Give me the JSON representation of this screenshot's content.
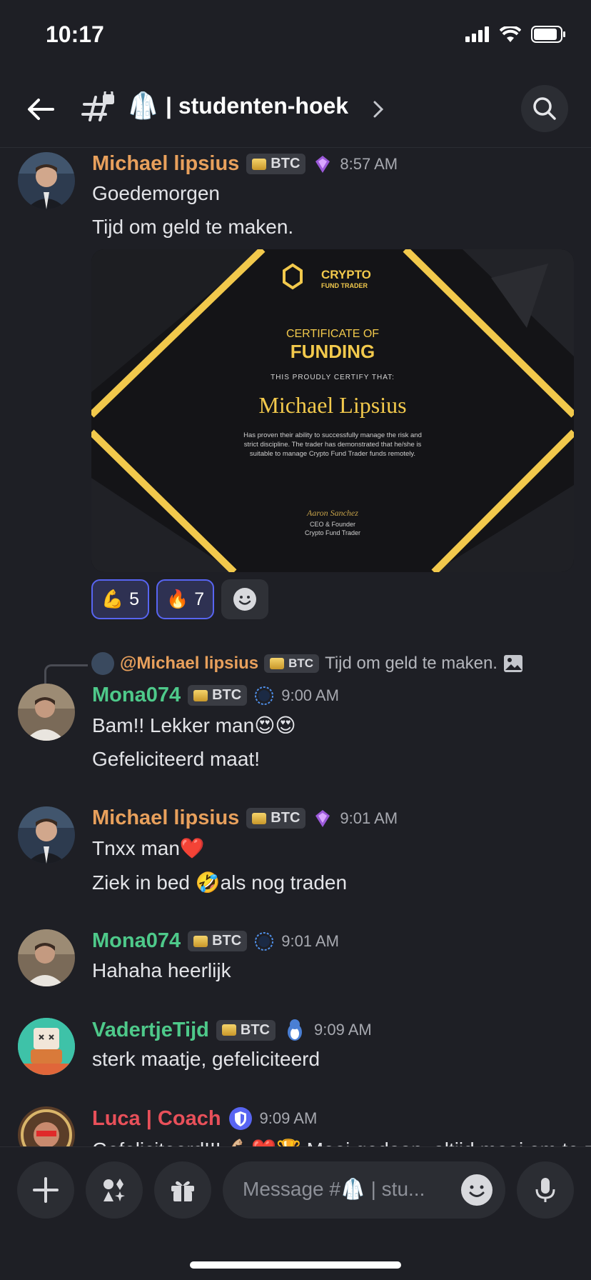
{
  "status": {
    "time": "10:17"
  },
  "header": {
    "channel_emoji": "🥼",
    "title": "| studenten-hoek"
  },
  "messages": [
    {
      "author": "Michael lipsius",
      "badge": "BTC",
      "time": "8:57 AM",
      "lines": [
        "Goedemorgen",
        "Tijd om geld te maken."
      ]
    },
    {
      "author": "Mona074",
      "badge": "BTC",
      "time": "9:00 AM",
      "lines": [
        "Bam!! Lekker man😍😍",
        "Gefeliciteerd maat!"
      ]
    },
    {
      "author": "Michael lipsius",
      "badge": "BTC",
      "time": "9:01 AM",
      "lines": [
        "Tnxx man❤️",
        "Ziek in bed 🤣als nog traden"
      ]
    },
    {
      "author": "Mona074",
      "badge": "BTC",
      "time": "9:01 AM",
      "lines": [
        "Hahaha heerlijk"
      ]
    },
    {
      "author": "VadertjeTijd",
      "badge": "BTC",
      "time": "9:09 AM",
      "lines": [
        "sterk maatje, gefeliciteerd"
      ]
    },
    {
      "author": "Luca | Coach",
      "time": "9:09 AM",
      "lines": [
        "Gefeliciteerd!!! 💪🏼❤️🏆 Mooi gedaan, altijd mooi om te zien"
      ]
    }
  ],
  "certificate": {
    "brand": "CRYPTO",
    "brand_sub": "FUND TRADER",
    "heading": "CERTIFICATE OF",
    "heading_big": "FUNDING",
    "certify": "THIS PROUDLY CERTIFY THAT:",
    "name": "Michael Lipsius",
    "body": [
      "Has proven their ability to successfully manage the risk and",
      "strict discipline. The trader has demonstrated that he/she is",
      "suitable to manage Crypto Fund Trader funds remotely."
    ],
    "signature": "Aaron Sanchez",
    "signer_title": "CEO & Founder",
    "signer_company": "Crypto Fund Trader"
  },
  "reactions": [
    {
      "emoji": "💪",
      "count": "5"
    },
    {
      "emoji": "🔥",
      "count": "7"
    }
  ],
  "reply": {
    "mention": "@Michael lipsius",
    "badge": "BTC",
    "text": "Tijd om geld te maken."
  },
  "composer": {
    "placeholder": "Message #🥼 | stu..."
  },
  "colors": {
    "background": "#1e1f25",
    "accent": "#5865f2",
    "gold": "#f2c94c"
  },
  "icons": [
    "back-arrow-icon",
    "text-channel-lock-icon",
    "chevron-right-icon",
    "search-icon",
    "plus-icon",
    "apps-icon",
    "gift-icon",
    "emoji-icon",
    "mic-icon",
    "image-icon"
  ]
}
